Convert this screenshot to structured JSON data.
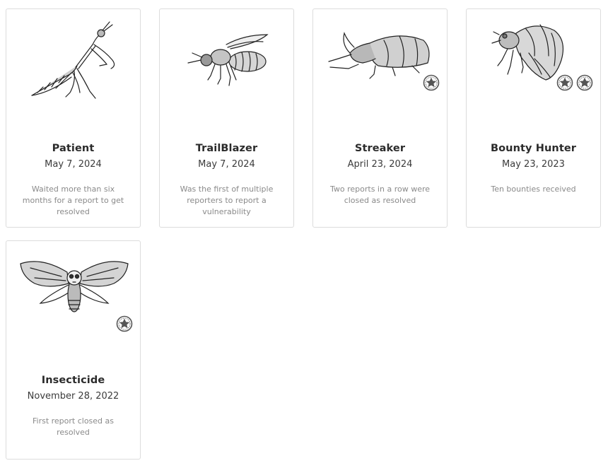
{
  "badges": [
    {
      "title": "Patient",
      "date": "May 7, 2024",
      "description": "Waited more than six months for a report to get resolved",
      "illustration": "mantis-icon",
      "stars": 0
    },
    {
      "title": "TrailBlazer",
      "date": "May 7, 2024",
      "description": "Was the first of multiple reporters to report a vulnerability",
      "illustration": "wasp-icon",
      "stars": 0
    },
    {
      "title": "Streaker",
      "date": "April 23, 2024",
      "description": "Two reports in a row were closed as resolved",
      "illustration": "rhino-beetle-icon",
      "stars": 1
    },
    {
      "title": "Bounty Hunter",
      "date": "May 23, 2023",
      "description": "Ten bounties received",
      "illustration": "cicada-icon",
      "stars": 2
    },
    {
      "title": "Insecticide",
      "date": "November 28, 2022",
      "description": "First report closed as resolved",
      "illustration": "deaths-head-moth-icon",
      "stars": 1
    }
  ],
  "colors": {
    "card_border": "#dcdcdc",
    "title": "#2b2b2b",
    "date": "#3b3b3b",
    "description": "#8a8a8a",
    "star_badge": "#555555"
  }
}
